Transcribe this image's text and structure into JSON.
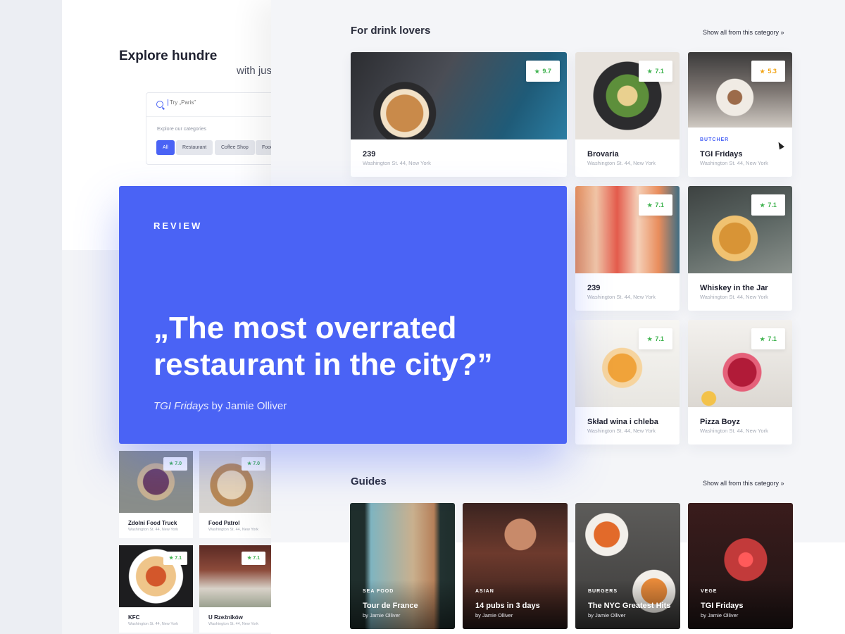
{
  "back": {
    "hero_title": "Explore hundre",
    "hero_sub": "with jus",
    "search_placeholder": "Try „Paris”",
    "categories_label": "Explore our categories",
    "chips": [
      "All",
      "Restaurant",
      "Coffee Shop",
      "Food"
    ],
    "mini_cards": [
      {
        "name": "Zdolni Food Truck",
        "address": "Washington St. 44, New York",
        "rating": "7.0"
      },
      {
        "name": "Food Patrol",
        "address": "Washington St. 44, New York",
        "rating": "7.0"
      },
      {
        "name": "KFC",
        "address": "Washington St. 44, New York",
        "rating": "7.1"
      },
      {
        "name": "U Rzeźników",
        "address": "Washington St. 44, New York",
        "rating": "7.1"
      }
    ]
  },
  "drinks": {
    "title": "For drink lovers",
    "show_all": "Show all from this category »",
    "cards": [
      {
        "name": "239",
        "address": "Washington St. 44, New York",
        "rating": "9.7",
        "category": ""
      },
      {
        "name": "Brovaria",
        "address": "Washington St. 44, New York",
        "rating": "7.1",
        "category": ""
      },
      {
        "name": "TGI Fridays",
        "address": "Washington St. 44, New York",
        "rating": "5.3",
        "category": "BUTCHER"
      },
      {
        "name": "239",
        "address": "Washington St. 44, New York",
        "rating": "7.1",
        "category": ""
      },
      {
        "name": "Whiskey in the Jar",
        "address": "Washington St. 44, New York",
        "rating": "7.1",
        "category": ""
      },
      {
        "name": "Skład wina i chleba",
        "address": "Washington St. 44, New York",
        "rating": "7.1",
        "category": ""
      },
      {
        "name": "Pizza Boyz",
        "address": "Washington St. 44, New York",
        "rating": "7.1",
        "category": ""
      }
    ]
  },
  "guides": {
    "title": "Guides",
    "show_all": "Show all from this category »",
    "items": [
      {
        "category": "SEA FOOD",
        "title": "Tour de France",
        "author": "by Jamie Olliver"
      },
      {
        "category": "ASIAN",
        "title": "14 pubs in 3 days",
        "author": "by Jamie Olliver"
      },
      {
        "category": "BURGERS",
        "title": "The NYC Greatest Hits",
        "author": "by Jamie Olliver"
      },
      {
        "category": "VEGE",
        "title": "TGI Fridays",
        "author": "by Jamie Olliver"
      }
    ]
  },
  "review": {
    "label": "REVIEW",
    "quote": "„The most overrated restaurant in the city?”",
    "venue": "TGI Fridays",
    "by": " by Jamie Olliver"
  },
  "colors": {
    "accent": "#4a63f5",
    "rating_green": "#3fb34f",
    "rating_orange": "#f2a516"
  }
}
